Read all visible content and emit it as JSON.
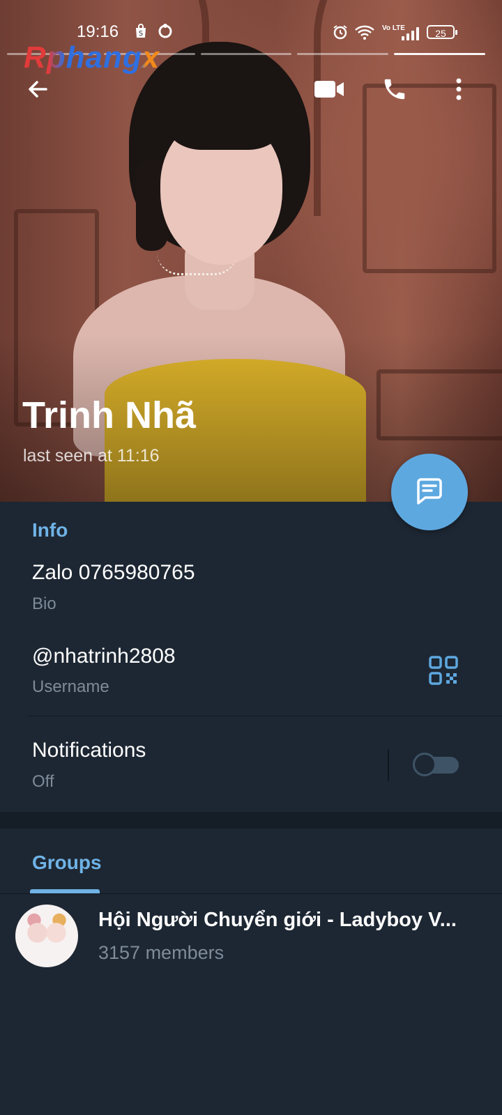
{
  "status_bar": {
    "time": "19:16",
    "battery": "25",
    "network_label": "Vo LTE",
    "icons": [
      "shopping-bag-icon",
      "sync-circle-icon",
      "alarm-icon",
      "wifi-icon",
      "volte-icon",
      "signal-icon",
      "battery-icon"
    ]
  },
  "watermark": "Rphangx",
  "story": {
    "segments": 5,
    "active_index": 4
  },
  "toolbar": {
    "icons": [
      "back-arrow-icon",
      "video-call-icon",
      "phone-icon",
      "more-vertical-icon"
    ]
  },
  "profile": {
    "name": "Trinh Nhã",
    "last_seen": "last seen at 11:16"
  },
  "fab": {
    "icon": "message-icon"
  },
  "info": {
    "title": "Info",
    "bio_value": "Zalo 0765980765",
    "bio_label": "Bio",
    "username_value": "@nhatrinh2808",
    "username_label": "Username",
    "notifications_value": "Notifications",
    "notifications_label": "Off",
    "notifications_enabled": false
  },
  "tabs": {
    "groups_label": "Groups"
  },
  "groups": [
    {
      "name": "Hội Người Chuyển giới - Ladyboy V...",
      "members": "3157 members"
    }
  ],
  "colors": {
    "accent": "#6fb3e6",
    "fab": "#5ea8e0",
    "background": "#1d2733",
    "secondary_text": "#7e8b99"
  }
}
